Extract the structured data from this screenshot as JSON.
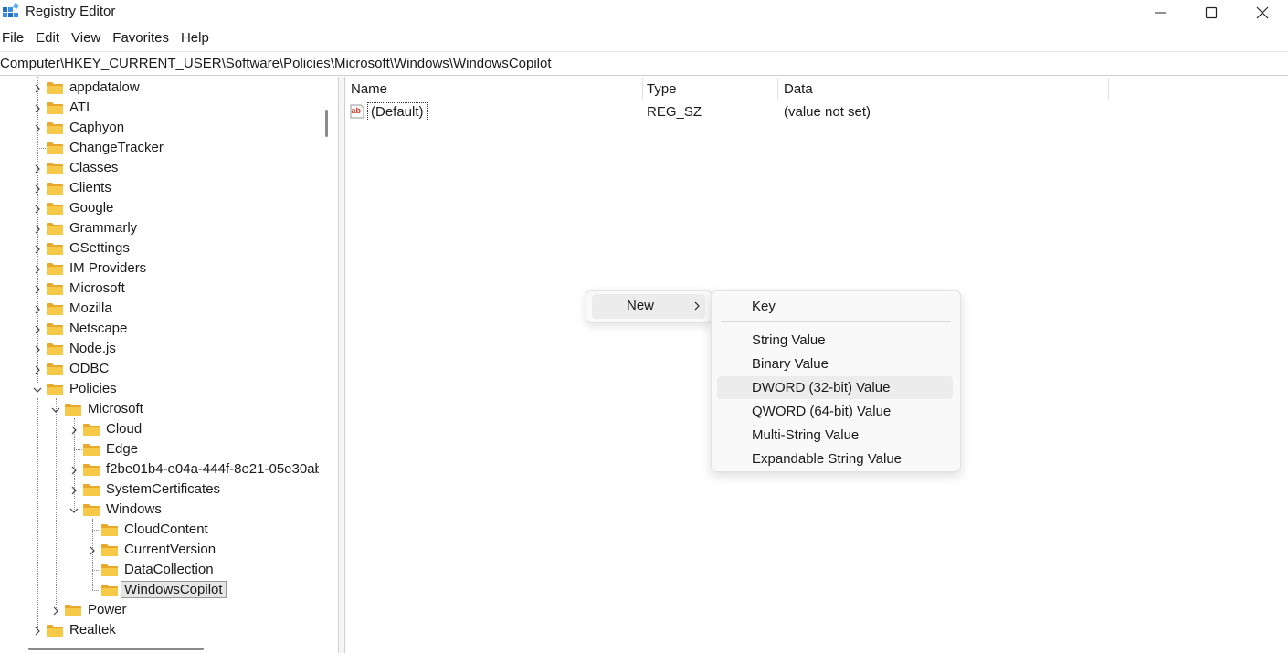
{
  "window": {
    "title": "Registry Editor"
  },
  "menu": [
    "File",
    "Edit",
    "View",
    "Favorites",
    "Help"
  ],
  "address": "Computer\\HKEY_CURRENT_USER\\Software\\Policies\\Microsoft\\Windows\\WindowsCopilot",
  "tree": [
    {
      "label": "appdatalow",
      "level": 0,
      "expand": "collapsed"
    },
    {
      "label": "ATI",
      "level": 0,
      "expand": "collapsed"
    },
    {
      "label": "Caphyon",
      "level": 0,
      "expand": "collapsed"
    },
    {
      "label": "ChangeTracker",
      "level": 0,
      "expand": "none"
    },
    {
      "label": "Classes",
      "level": 0,
      "expand": "collapsed"
    },
    {
      "label": "Clients",
      "level": 0,
      "expand": "collapsed"
    },
    {
      "label": "Google",
      "level": 0,
      "expand": "collapsed"
    },
    {
      "label": "Grammarly",
      "level": 0,
      "expand": "collapsed"
    },
    {
      "label": "GSettings",
      "level": 0,
      "expand": "collapsed"
    },
    {
      "label": "IM Providers",
      "level": 0,
      "expand": "collapsed"
    },
    {
      "label": "Microsoft",
      "level": 0,
      "expand": "collapsed"
    },
    {
      "label": "Mozilla",
      "level": 0,
      "expand": "collapsed"
    },
    {
      "label": "Netscape",
      "level": 0,
      "expand": "collapsed"
    },
    {
      "label": "Node.js",
      "level": 0,
      "expand": "collapsed"
    },
    {
      "label": "ODBC",
      "level": 0,
      "expand": "collapsed"
    },
    {
      "label": "Policies",
      "level": 0,
      "expand": "expanded"
    },
    {
      "label": "Microsoft",
      "level": 1,
      "expand": "expanded"
    },
    {
      "label": "Cloud",
      "level": 2,
      "expand": "collapsed"
    },
    {
      "label": "Edge",
      "level": 2,
      "expand": "none"
    },
    {
      "label": "f2be01b4-e04a-444f-8e21-05e30ab",
      "level": 2,
      "expand": "collapsed"
    },
    {
      "label": "SystemCertificates",
      "level": 2,
      "expand": "collapsed"
    },
    {
      "label": "Windows",
      "level": 2,
      "expand": "expanded"
    },
    {
      "label": "CloudContent",
      "level": 3,
      "expand": "none"
    },
    {
      "label": "CurrentVersion",
      "level": 3,
      "expand": "collapsed"
    },
    {
      "label": "DataCollection",
      "level": 3,
      "expand": "none"
    },
    {
      "label": "WindowsCopilot",
      "level": 3,
      "expand": "none",
      "selected": true
    },
    {
      "label": "Power",
      "level": 1,
      "expand": "collapsed"
    },
    {
      "label": "Realtek",
      "level": 0,
      "expand": "collapsed"
    }
  ],
  "list": {
    "columns": [
      "Name",
      "Type",
      "Data"
    ],
    "rows": [
      {
        "name": "(Default)",
        "type": "REG_SZ",
        "data": "(value not set)",
        "icon": "string-value-icon"
      }
    ]
  },
  "context_menu": {
    "new_label": "New",
    "submenu": [
      "Key",
      "String Value",
      "Binary Value",
      "DWORD (32-bit) Value",
      "QWORD (64-bit) Value",
      "Multi-String Value",
      "Expandable String Value"
    ],
    "hovered": "DWORD (32-bit) Value"
  },
  "colors": {
    "folder": "#f7c948",
    "folder_dark": "#e8a82b",
    "selection": "#e5e5e5",
    "accent": "#0067c0"
  }
}
